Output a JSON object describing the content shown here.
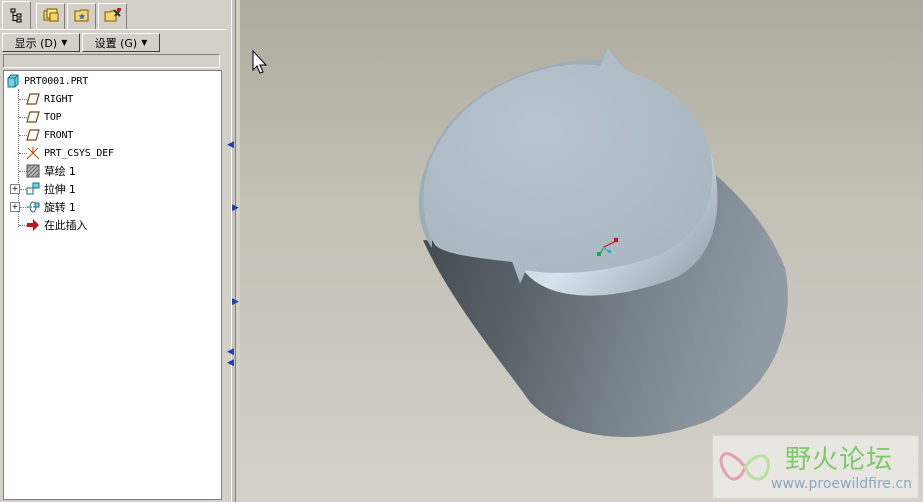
{
  "tabs": [
    {
      "icon": "model-tree-icon",
      "active": true
    },
    {
      "icon": "folder-browser-icon",
      "active": false
    },
    {
      "icon": "favorites-icon",
      "active": false
    },
    {
      "icon": "connections-icon",
      "active": false
    }
  ],
  "menu": {
    "display_label": "显示 (D)",
    "settings_label": "设置 (G)"
  },
  "tree": {
    "root": "PRT0001.PRT",
    "items": [
      {
        "label": "RIGHT",
        "icon": "datum-plane-icon"
      },
      {
        "label": "TOP",
        "icon": "datum-plane-icon"
      },
      {
        "label": "FRONT",
        "icon": "datum-plane-icon"
      },
      {
        "label": "PRT_CSYS_DEF",
        "icon": "coordinate-system-icon"
      },
      {
        "label": "草绘 1",
        "icon": "sketch-icon"
      },
      {
        "label": "拉伸 1",
        "icon": "extrude-icon"
      },
      {
        "label": "旋转 1",
        "icon": "revolve-icon"
      },
      {
        "label": "在此插入",
        "icon": "insert-here-arrow-icon"
      }
    ]
  },
  "watermark": {
    "title": "野火论坛",
    "url": "www.proewildfire.cn"
  },
  "colors": {
    "accent": "#1a3fb0",
    "model_light": "#c5d2dc",
    "model_dark": "#4a5158",
    "insert_arrow": "#c0141c"
  }
}
